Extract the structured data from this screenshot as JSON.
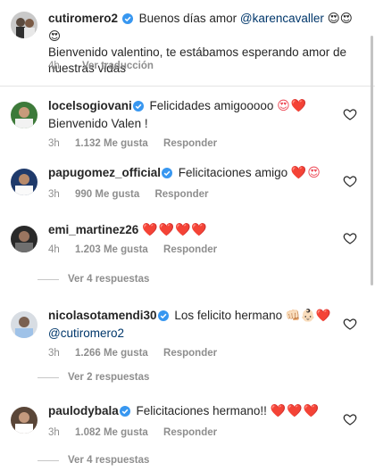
{
  "caption": {
    "username": "cutiromero2",
    "greeting": "Buenos días amor",
    "mention": "@karencavaller",
    "emojis": "😍😍😍",
    "body": "Bienvenido valentino, te estábamos esperando amor de nuestras vidas",
    "time": "4h",
    "see_translation": "Ver traducción"
  },
  "comments": [
    {
      "username": "locelsogiovani",
      "text": "Felicidades amigooooo",
      "emojis": "😍❤️",
      "text2": "Bienvenido Valen !",
      "time": "3h",
      "likes": "1.132 Me gusta",
      "reply": "Responder"
    },
    {
      "username": "papugomez_official",
      "text": "Felicitaciones amigo",
      "emojis": "❤️😍",
      "time": "3h",
      "likes": "990 Me gusta",
      "reply": "Responder"
    },
    {
      "username": "emi_martinez26",
      "text": "",
      "emojis": "❤️❤️❤️❤️",
      "time": "4h",
      "likes": "1.203 Me gusta",
      "reply": "Responder",
      "view_replies": "Ver 4 respuestas"
    },
    {
      "username": "nicolasotamendi30",
      "text": "Los felicito hermano",
      "emojis": "👊🏻👶🏻❤️",
      "mention": "@cutiromero2",
      "time": "3h",
      "likes": "1.266 Me gusta",
      "reply": "Responder",
      "view_replies": "Ver 2 respuestas"
    },
    {
      "username": "paulodybala",
      "text": "Felicitaciones hermano!!",
      "emojis": "❤️❤️❤️",
      "time": "3h",
      "likes": "1.082 Me gusta",
      "reply": "Responder",
      "view_replies": "Ver 4 respuestas"
    }
  ],
  "icons": {
    "verified": "verified-badge-icon",
    "like": "heart-outline-icon"
  },
  "colors": {
    "verified_blue": "#3897f0",
    "heart_red": "#ed4956",
    "mention_blue": "#00376b",
    "meta_gray": "#8e8e8e"
  }
}
